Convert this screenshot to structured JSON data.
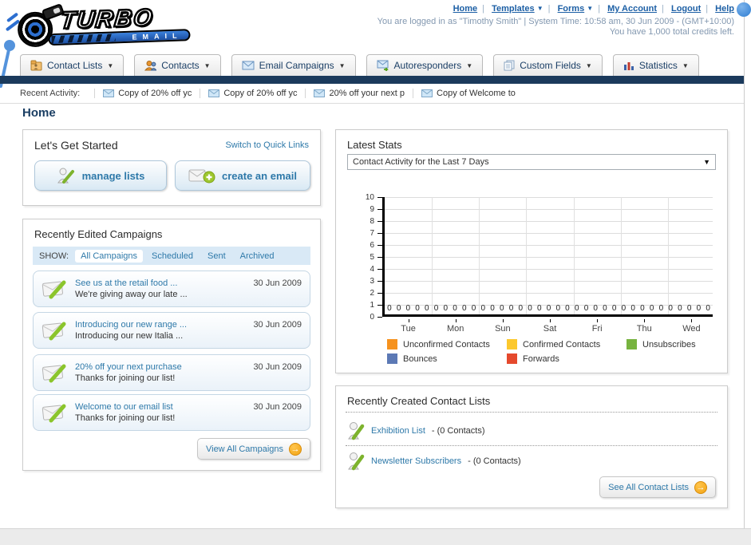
{
  "brand": {
    "line1": "TURBO",
    "line2": "EMAIL"
  },
  "header": {
    "links": [
      {
        "label": "Home"
      },
      {
        "label": "Templates",
        "dropdown": true
      },
      {
        "label": "Forms",
        "dropdown": true
      },
      {
        "label": "My Account"
      },
      {
        "label": "Logout"
      },
      {
        "label": "Help"
      }
    ],
    "status_line1": "You are logged in as \"Timothy Smith\" | System Time: 10:58 am, 30 Jun 2009 - (GMT+10:00)",
    "status_line2": "You have 1,000 total credits left."
  },
  "nav": {
    "tabs": [
      {
        "label": "Contact Lists"
      },
      {
        "label": "Contacts"
      },
      {
        "label": "Email Campaigns"
      },
      {
        "label": "Autoresponders"
      },
      {
        "label": "Custom Fields"
      },
      {
        "label": "Statistics"
      }
    ]
  },
  "recent_activity": {
    "label": "Recent Activity:",
    "items": [
      "Copy of 20% off yc",
      "Copy of 20% off yc",
      "20% off your next p",
      "Copy of Welcome to"
    ]
  },
  "page_title": "Home",
  "get_started": {
    "title": "Let's Get Started",
    "switch_link": "Switch to Quick Links",
    "manage_lists_label": "manage lists",
    "create_email_label": "create an email"
  },
  "campaigns": {
    "title": "Recently Edited Campaigns",
    "show_label": "SHOW:",
    "filters": [
      "All Campaigns",
      "Scheduled",
      "Sent",
      "Archived"
    ],
    "active_filter": "All Campaigns",
    "items": [
      {
        "title": "See us at the retail food ...",
        "subtitle": "We're giving away our late ...",
        "date": "30 Jun 2009"
      },
      {
        "title": "Introducing our new range ...",
        "subtitle": "Introducing our new Italia ...",
        "date": "30 Jun 2009"
      },
      {
        "title": "20% off your next purchase",
        "subtitle": "Thanks for joining our list!",
        "date": "30 Jun 2009"
      },
      {
        "title": "Welcome to our email list",
        "subtitle": "Thanks for joining our list!",
        "date": "30 Jun 2009"
      }
    ],
    "view_all_label": "View All Campaigns"
  },
  "stats": {
    "title": "Latest Stats",
    "dropdown_value": "Contact Activity for the Last 7 Days"
  },
  "chart_data": {
    "type": "bar",
    "title": "Contact Activity for the Last 7 Days",
    "categories": [
      "Tue",
      "Mon",
      "Sun",
      "Sat",
      "Fri",
      "Thu",
      "Wed"
    ],
    "series": [
      {
        "name": "Unconfirmed Contacts",
        "color": "#F6921E",
        "values": [
          0,
          0,
          0,
          0,
          0,
          0,
          0
        ]
      },
      {
        "name": "Confirmed Contacts",
        "color": "#FCC82D",
        "values": [
          0,
          0,
          0,
          0,
          0,
          0,
          0
        ]
      },
      {
        "name": "Unsubscribes",
        "color": "#77B33F",
        "values": [
          0,
          0,
          0,
          0,
          0,
          0,
          0
        ]
      },
      {
        "name": "Bounces",
        "color": "#5C79B5",
        "values": [
          0,
          0,
          0,
          0,
          0,
          0,
          0
        ]
      },
      {
        "name": "Forwards",
        "color": "#E5492D",
        "values": [
          0,
          0,
          0,
          0,
          0,
          0,
          0
        ]
      }
    ],
    "ylim": [
      0,
      10
    ],
    "ytick_step": 1,
    "grid": true,
    "legend_position": "bottom",
    "xlabel": "",
    "ylabel": ""
  },
  "contact_lists": {
    "title": "Recently Created Contact Lists",
    "items": [
      {
        "name": "Exhibition List",
        "detail": "- (0 Contacts)"
      },
      {
        "name": "Newsletter Subscribers",
        "detail": "- (0 Contacts)"
      }
    ],
    "see_all_label": "See All Contact Lists"
  },
  "colors": {
    "navy_bar": "#1B3A5C",
    "link_blue": "#1C5FA5",
    "panel_link_blue": "#2E79A9",
    "accent_orange": "#F2A313",
    "filter_bar_bg": "#D9E9F6"
  }
}
